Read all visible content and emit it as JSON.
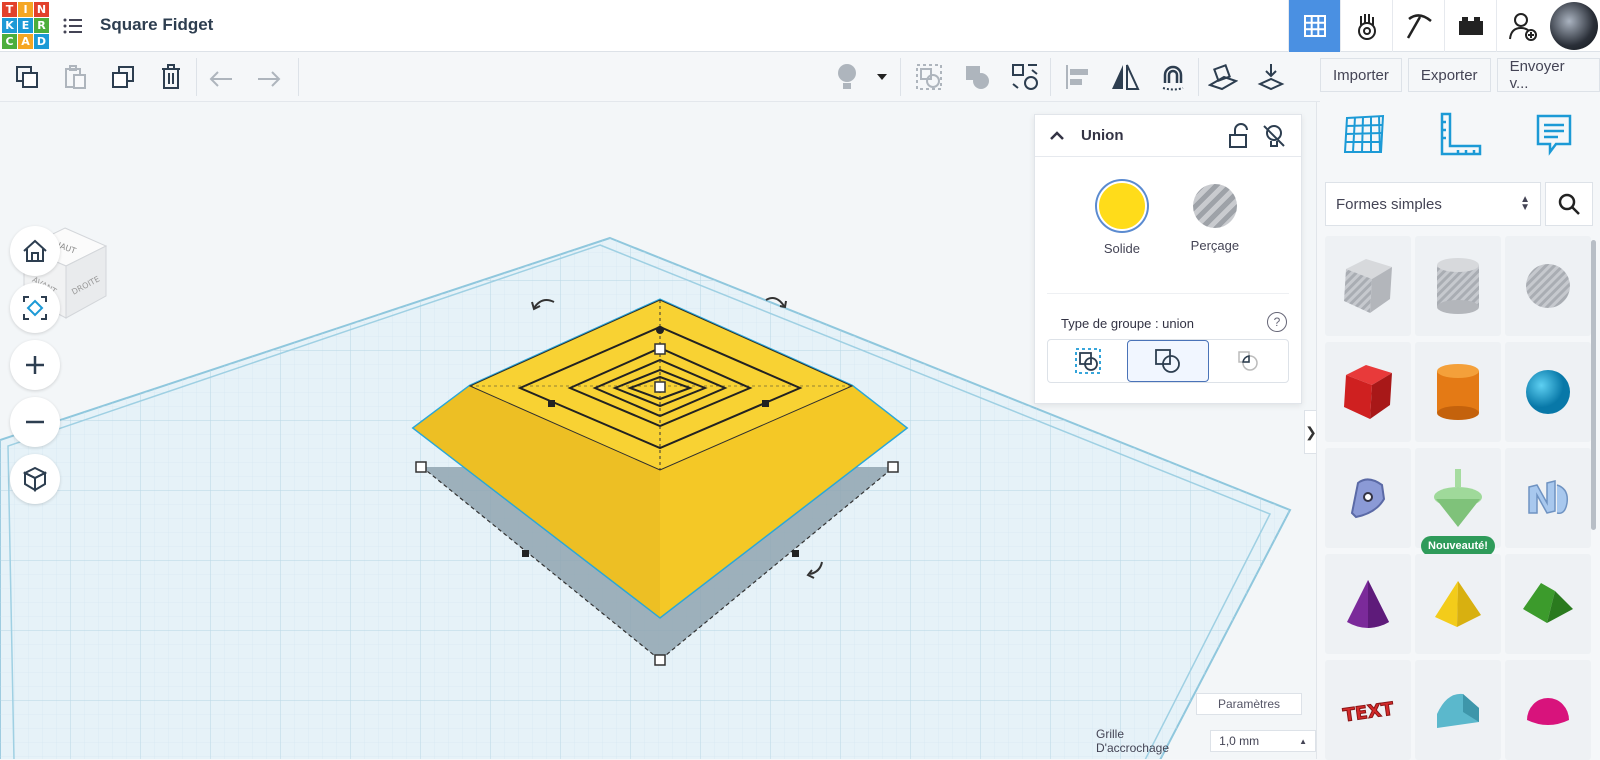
{
  "app": {
    "logo_letters": [
      "T",
      "I",
      "N",
      "K",
      "E",
      "R",
      "C",
      "A",
      "D"
    ],
    "logo_colors": [
      "#e2412b",
      "#f5a623",
      "#e2412b",
      "#1c9ad6",
      "#1c9ad6",
      "#4cae3c",
      "#4cae3c",
      "#f5a623",
      "#1c9ad6"
    ],
    "project_title": "Square Fidget",
    "accent": "#4a90e2"
  },
  "header": {
    "nav_icons": [
      "grid-view-icon",
      "sim-lab-icon",
      "pickaxe-icon",
      "brick-icon",
      "add-user-icon"
    ]
  },
  "toolbar": {
    "left_icons": [
      "copy-icon",
      "paste-icon",
      "duplicate-icon",
      "delete-icon",
      "undo-icon",
      "redo-icon"
    ],
    "right_icons": [
      "light-icon",
      "dropdown-icon",
      "group-icon",
      "ungroup-icon",
      "align-icon",
      "distribute-icon",
      "mirror-icon",
      "magnet-icon",
      "workplane-icon",
      "drop-icon"
    ]
  },
  "actions": {
    "import_label": "Importer",
    "export_label": "Exporter",
    "send_label": "Envoyer v..."
  },
  "view_cube": {
    "top": "HAUT",
    "front": "AVANT",
    "right": "DROITE"
  },
  "inspector": {
    "title": "Union",
    "solid_label": "Solide",
    "hole_label": "Perçage",
    "solid_color": "#ffdc1a",
    "group_type_label": "Type de groupe : union",
    "help": "?"
  },
  "canvas": {
    "params_label": "Paramètres",
    "snap_label": "Grille D'accrochage",
    "snap_value": "1,0 mm",
    "object_color": "#f6cc27"
  },
  "panel": {
    "category": "Formes simples",
    "new_badge": "Nouveauté!",
    "shapes": [
      "box-hole",
      "cylinder-hole",
      "sphere-hole",
      "box",
      "cylinder",
      "sphere",
      "scribble",
      "spin-top",
      "text-3d",
      "cone",
      "pyramid",
      "roof",
      "text",
      "half-cylinder",
      "half-sphere"
    ]
  }
}
